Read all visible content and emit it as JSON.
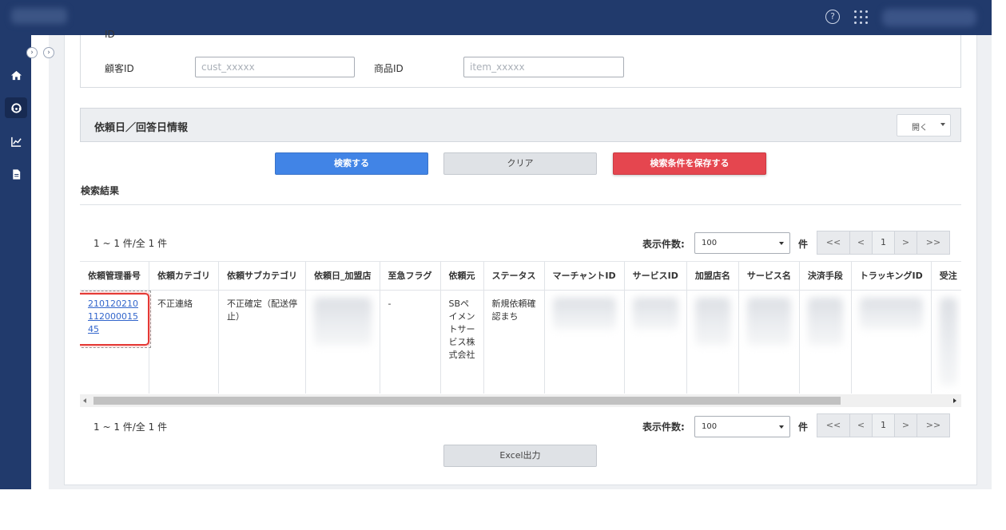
{
  "filters": {
    "top_label": "ID",
    "customer_id_label": "顧客ID",
    "customer_id_placeholder": "cust_xxxxx",
    "product_id_label": "商品ID",
    "product_id_placeholder": "item_xxxxx"
  },
  "request_panel": {
    "title": "依頼日／回答日情報",
    "toggle_label": "開く"
  },
  "actions": {
    "search": "検索する",
    "clear": "クリア",
    "save_conditions": "検索条件を保存する",
    "excel_export": "Excel出力"
  },
  "results": {
    "title": "検索結果",
    "count_text": "1 ~ 1 件/全 1 件",
    "page_size_label": "表示件数:",
    "page_size_value": "100",
    "page_size_unit": "件",
    "pager": {
      "first": "<<",
      "prev": "<",
      "current": "1",
      "next": ">",
      "last": ">>"
    },
    "columns": [
      "依頼管理番号",
      "依頼カテゴリ",
      "依頼サブカテゴリ",
      "依頼日_加盟店",
      "至急フラグ",
      "依頼元",
      "ステータス",
      "マーチャントID",
      "サービスID",
      "加盟店名",
      "サービス名",
      "決済手段",
      "トラッキングID",
      "受注"
    ],
    "row": {
      "request_number": "210120210112000015 45",
      "category": "不正連絡",
      "subcategory": "不正確定（配送停止）",
      "urgent_flag": "-",
      "requester": "SBペイメントサービス株式会社",
      "status": "新規依頼確認まち"
    }
  },
  "colors": {
    "nav_bg": "#213a6c",
    "primary": "#4184e6",
    "danger": "#e5464f",
    "link": "#3366cc",
    "highlight": "#e53935"
  }
}
